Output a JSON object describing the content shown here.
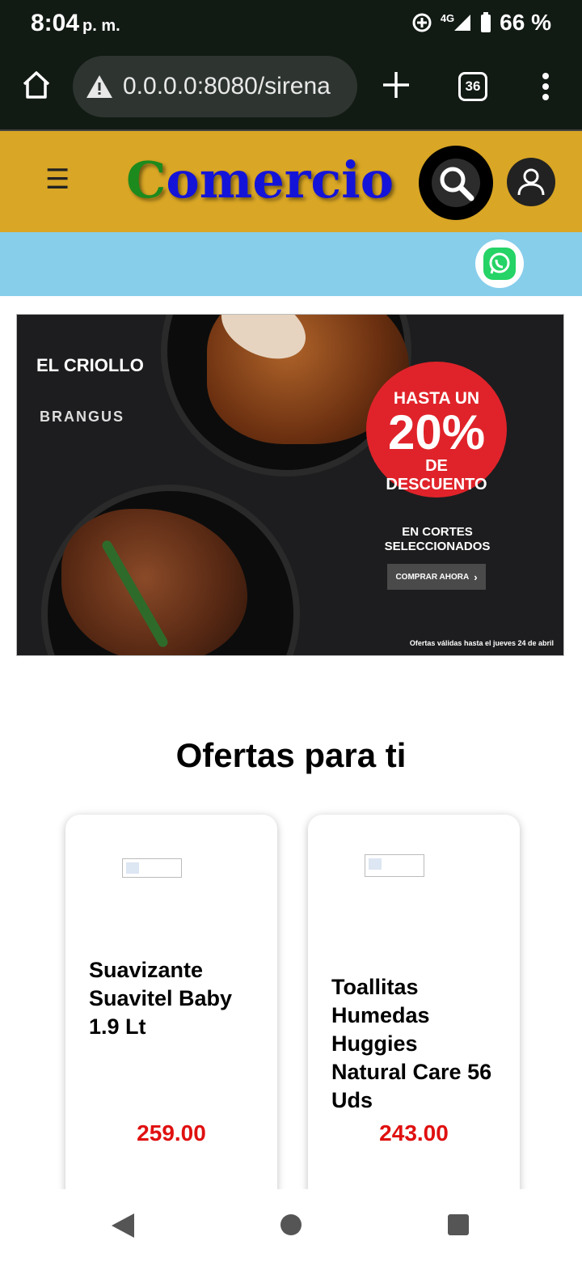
{
  "status_bar": {
    "time": "8:04",
    "ampm": "p. m.",
    "network": "4G",
    "battery": "66 %"
  },
  "browser": {
    "url": "0.0.0.0:8080/sirena",
    "tab_count": "36"
  },
  "header": {
    "logo_first": "C",
    "logo_rest": "omercio"
  },
  "banner": {
    "brand_1": "EL CRIOLLO",
    "brand_2": "BRANGUS",
    "badge_line1": "HASTA UN",
    "badge_pct": "20%",
    "badge_line3": "DE",
    "badge_line4": "DESCUENTO",
    "cortes": "EN CORTES SELECCIONADOS",
    "button": "COMPRAR AHORA",
    "valid_text": "Ofertas válidas hasta el jueves 24 de abril"
  },
  "offers": {
    "title": "Ofertas para ti",
    "items": [
      {
        "name": "Suavizante Suavitel Baby 1.9 Lt",
        "price": "259.00"
      },
      {
        "name": "Toallitas Humedas Huggies Natural Care 56 Uds",
        "price": "243.00"
      }
    ]
  },
  "colors": {
    "header_bg": "#d9a625",
    "strip_bg": "#87ceeb",
    "logo_blue": "#1414d8",
    "logo_green": "#1d8a1d",
    "price_red": "#e01010",
    "badge_red": "#e0232a"
  }
}
